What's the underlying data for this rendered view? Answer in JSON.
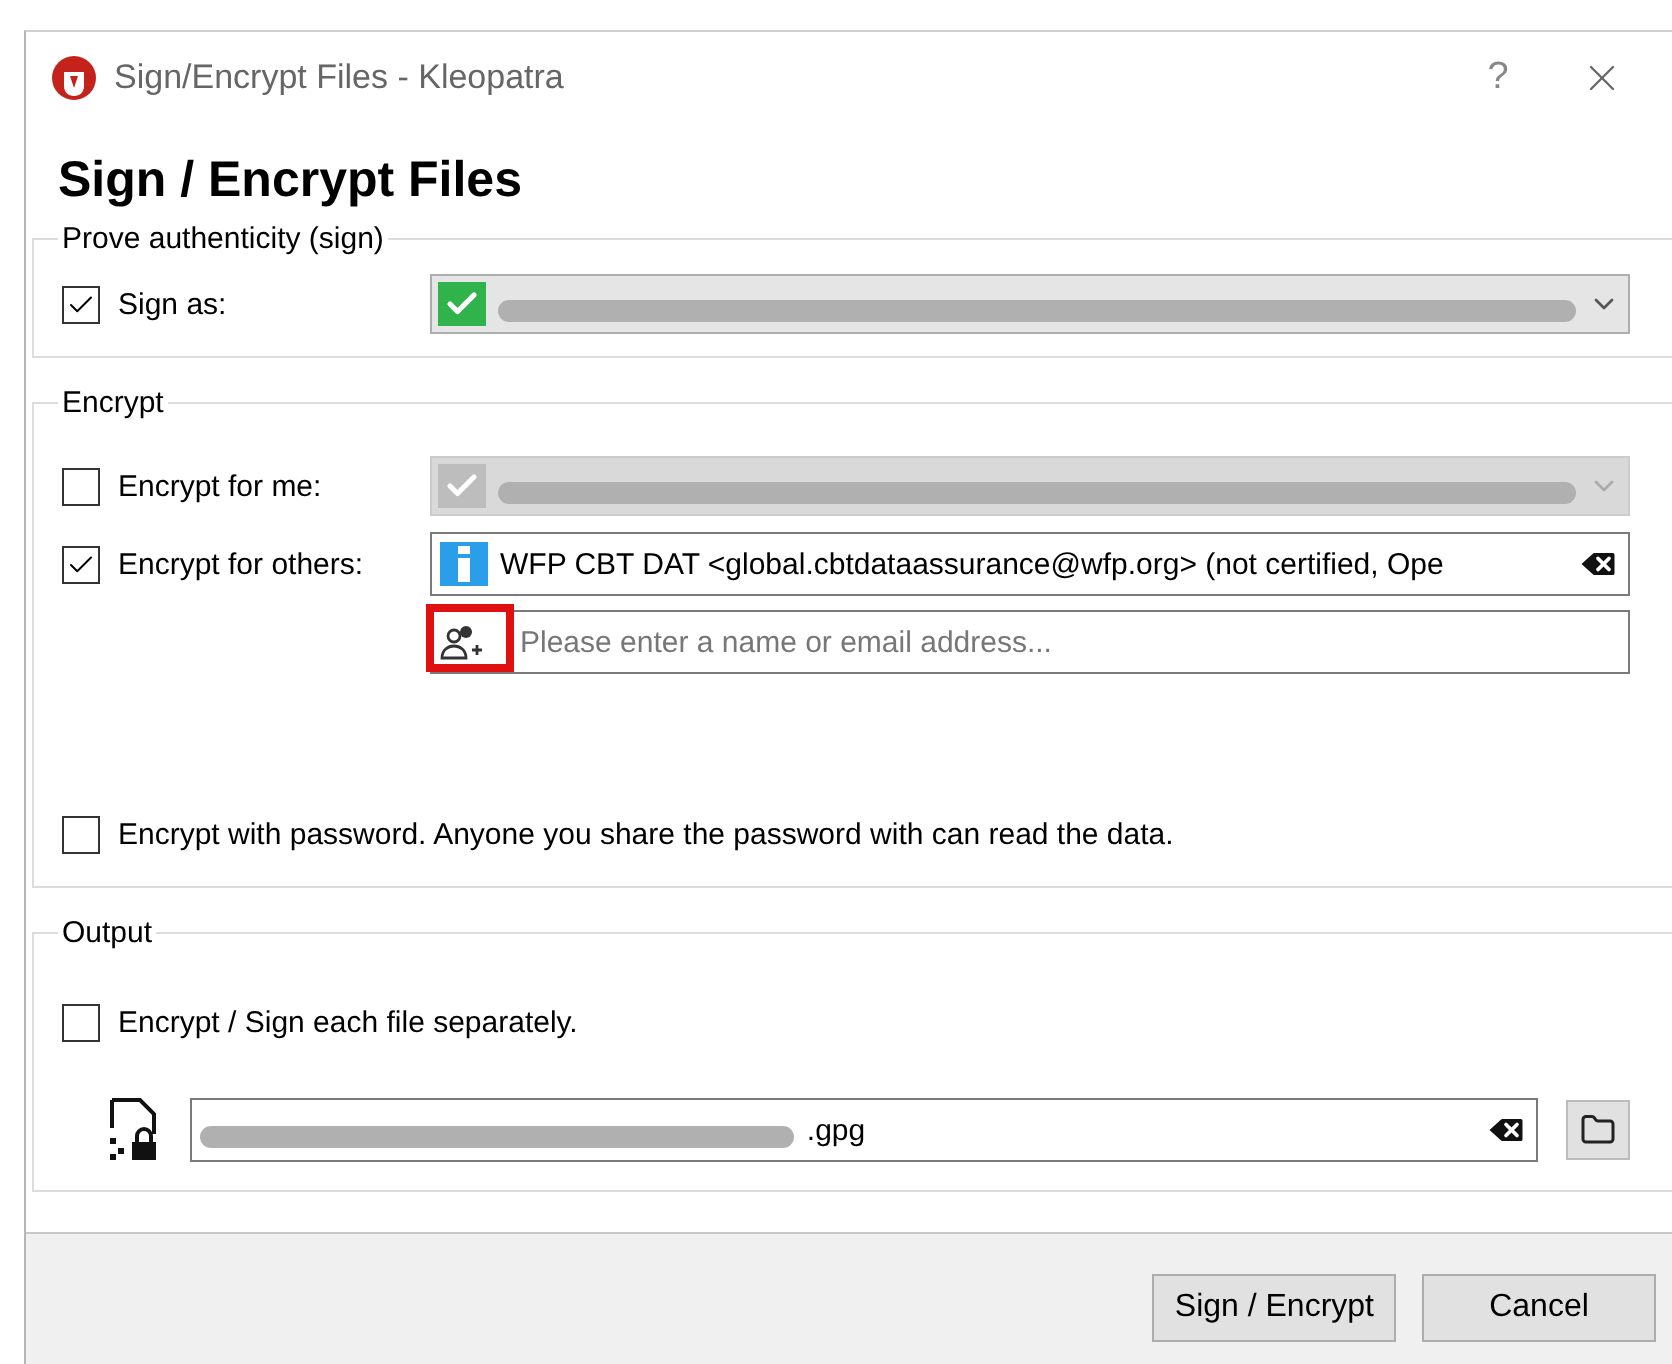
{
  "window": {
    "title": "Sign/Encrypt Files - Kleopatra",
    "help": "?"
  },
  "heading": "Sign / Encrypt Files",
  "sign_group": {
    "title": "Prove authenticity (sign)",
    "sign_as": {
      "label": "Sign as:",
      "checked": true
    }
  },
  "encrypt_group": {
    "title": "Encrypt",
    "for_me": {
      "label": "Encrypt for me:",
      "checked": false,
      "disabled": true
    },
    "for_others": {
      "label": "Encrypt for others:",
      "checked": true,
      "recipients": [
        {
          "text": "WFP CBT DAT <global.cbtdataassurance@wfp.org> (not certified, Ope"
        }
      ],
      "placeholder": "Please enter a name or email address..."
    },
    "password": {
      "label": "Encrypt with password. Anyone you share the password with can read the data.",
      "checked": false
    }
  },
  "output_group": {
    "title": "Output",
    "separately": {
      "label": "Encrypt / Sign each file separately.",
      "checked": false
    },
    "path_suffix": ".gpg"
  },
  "buttons": [
    {
      "label": "Sign / Encrypt"
    },
    {
      "label": "Cancel"
    }
  ]
}
